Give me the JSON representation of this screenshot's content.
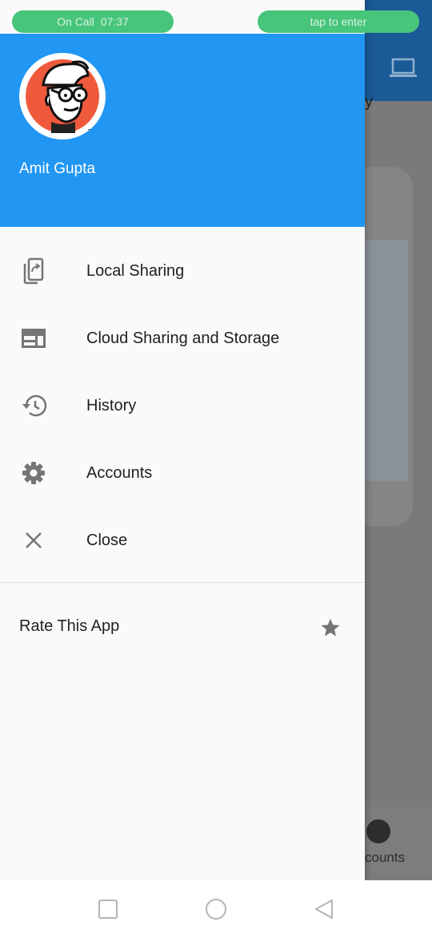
{
  "status": {
    "call_label": "On Call",
    "call_time": "07:37",
    "tap_label": "tap to enter"
  },
  "background": {
    "partial_title_char": "y",
    "bottom_nav_partial_label": "counts"
  },
  "drawer": {
    "user_name": "Amit Gupta",
    "items": [
      {
        "label": "Local Sharing",
        "icon": "phone-share-icon"
      },
      {
        "label": "Cloud Sharing and Storage",
        "icon": "web-layout-icon"
      },
      {
        "label": "History",
        "icon": "history-icon"
      },
      {
        "label": "Accounts",
        "icon": "gear-icon"
      },
      {
        "label": "Close",
        "icon": "close-icon"
      }
    ],
    "rate_label": "Rate This App",
    "rate_icon": "star-icon"
  },
  "colors": {
    "header": "#2196f3",
    "pill": "#47c57a",
    "icon": "#757575"
  }
}
